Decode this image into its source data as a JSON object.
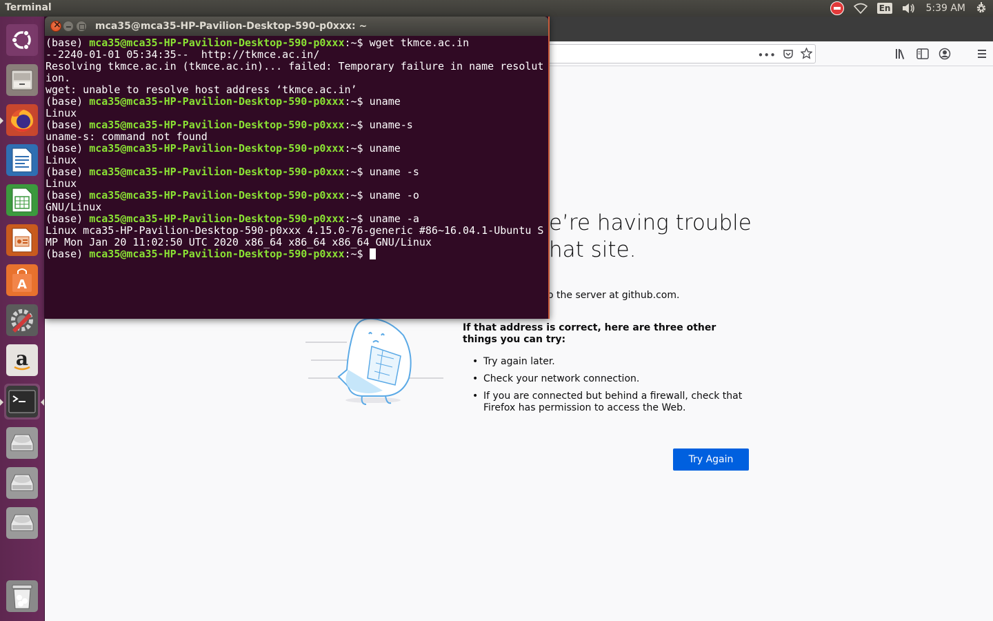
{
  "top_panel": {
    "app_title": "Terminal",
    "language": "En",
    "clock": "5:39 AM",
    "icons": [
      "no-entry-icon",
      "wifi-icon",
      "keyboard-language-icon",
      "volume-icon",
      "settings-gear-icon"
    ]
  },
  "launcher": {
    "items": [
      {
        "name": "ubuntu-dash",
        "icon": "ubuntu-logo-icon"
      },
      {
        "name": "files",
        "icon": "file-cabinet-icon"
      },
      {
        "name": "firefox",
        "icon": "firefox-icon",
        "running": true
      },
      {
        "name": "libreoffice-writer",
        "icon": "writer-document-icon"
      },
      {
        "name": "libreoffice-calc",
        "icon": "calc-spreadsheet-icon"
      },
      {
        "name": "libreoffice-impress",
        "icon": "impress-presentation-icon"
      },
      {
        "name": "ubuntu-software",
        "icon": "software-center-bag-icon"
      },
      {
        "name": "system-settings",
        "icon": "system-tools-icon"
      },
      {
        "name": "amazon",
        "icon": "amazon-logo-icon"
      },
      {
        "name": "terminal",
        "icon": "terminal-icon",
        "running": true,
        "focused": true
      },
      {
        "name": "drive-1",
        "icon": "hard-drive-icon"
      },
      {
        "name": "drive-2",
        "icon": "hard-drive-icon"
      },
      {
        "name": "drive-3",
        "icon": "hard-drive-icon"
      },
      {
        "name": "trash",
        "icon": "trash-icon"
      }
    ]
  },
  "terminal": {
    "title": "mca35@mca35-HP-Pavilion-Desktop-590-p0xxx: ~",
    "lines": [
      {
        "prefix": "(base) ",
        "host": "mca35@mca35-HP-Pavilion-Desktop-590-p0xxx",
        "path": ":~$ ",
        "cmd": "wget tkmce.ac.in"
      },
      {
        "text": "--2240-01-01 05:34:35--  http://tkmce.ac.in/"
      },
      {
        "text": "Resolving tkmce.ac.in (tkmce.ac.in)... failed: Temporary failure in name resolut"
      },
      {
        "text": "ion."
      },
      {
        "text": "wget: unable to resolve host address ‘tkmce.ac.in’"
      },
      {
        "prefix": "(base) ",
        "host": "mca35@mca35-HP-Pavilion-Desktop-590-p0xxx",
        "path": ":~$ ",
        "cmd": "uname"
      },
      {
        "text": "Linux"
      },
      {
        "prefix": "(base) ",
        "host": "mca35@mca35-HP-Pavilion-Desktop-590-p0xxx",
        "path": ":~$ ",
        "cmd": "uname-s"
      },
      {
        "text": "uname-s: command not found"
      },
      {
        "prefix": "(base) ",
        "host": "mca35@mca35-HP-Pavilion-Desktop-590-p0xxx",
        "path": ":~$ ",
        "cmd": "uname"
      },
      {
        "text": "Linux"
      },
      {
        "prefix": "(base) ",
        "host": "mca35@mca35-HP-Pavilion-Desktop-590-p0xxx",
        "path": ":~$ ",
        "cmd": "uname -s"
      },
      {
        "text": "Linux"
      },
      {
        "prefix": "(base) ",
        "host": "mca35@mca35-HP-Pavilion-Desktop-590-p0xxx",
        "path": ":~$ ",
        "cmd": "uname -o"
      },
      {
        "text": "GNU/Linux"
      },
      {
        "prefix": "(base) ",
        "host": "mca35@mca35-HP-Pavilion-Desktop-590-p0xxx",
        "path": ":~$ ",
        "cmd": "uname -a"
      },
      {
        "text": "Linux mca35-HP-Pavilion-Desktop-590-p0xxx 4.15.0-76-generic #86~16.04.1-Ubuntu S"
      },
      {
        "text": "MP Mon Jan 20 11:02:50 UTC 2020 x86_64 x86_64 x86_64 GNU/Linux"
      },
      {
        "prefix": "(base) ",
        "host": "mca35@mca35-HP-Pavilion-Desktop-590-p0xxx",
        "path": ":~$ ",
        "cmd": "",
        "cursor": true
      }
    ]
  },
  "firefox": {
    "url_icons": [
      "page-actions-icon",
      "pocket-icon",
      "bookmark-star-icon"
    ],
    "toolbar_icons": [
      "library-icon",
      "sidebar-icon",
      "account-icon",
      "menu-icon"
    ],
    "error": {
      "title_line1": "e’re having trouble",
      "title_line2": "hat site.",
      "description": "o the server at github.com.",
      "subheading": "If that address is correct, here are three other things you can try:",
      "items": [
        "Try again later.",
        "Check your network connection.",
        "If you are connected but behind a firewall, check that Firefox has permission to access the Web."
      ],
      "button": "Try Again"
    }
  }
}
